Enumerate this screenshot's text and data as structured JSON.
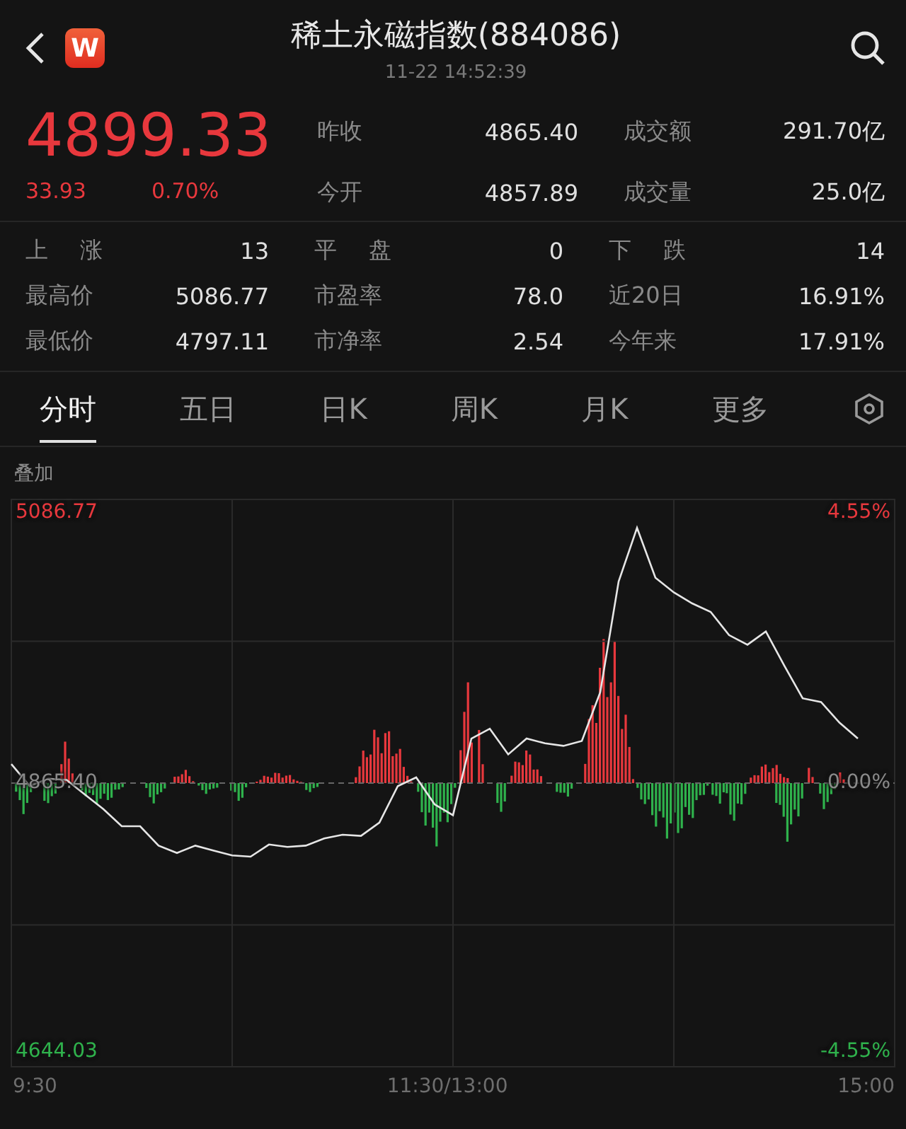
{
  "header": {
    "logo": "W",
    "title": "稀土永磁指数(884086)",
    "timestamp": "11-22 14:52:39"
  },
  "quote": {
    "price": "4899.33",
    "change": "33.93",
    "change_pct": "0.70%"
  },
  "summary": [
    {
      "label": "昨收",
      "value": "4865.40"
    },
    {
      "label": "成交额",
      "value": "291.70亿"
    },
    {
      "label": "今开",
      "value": "4857.89"
    },
    {
      "label": "成交量",
      "value": "25.0亿"
    }
  ],
  "stats": [
    {
      "label": "上 涨",
      "value": "13"
    },
    {
      "label": "平 盘",
      "value": "0"
    },
    {
      "label": "下 跌",
      "value": "14"
    },
    {
      "label": "最高价",
      "value": "5086.77"
    },
    {
      "label": "市盈率",
      "value": "78.0"
    },
    {
      "label": "近20日",
      "value": "16.91%"
    },
    {
      "label": "最低价",
      "value": "4797.11"
    },
    {
      "label": "市净率",
      "value": "2.54"
    },
    {
      "label": "今年来",
      "value": "17.91%"
    }
  ],
  "tabs": [
    {
      "label": "分时",
      "selected": true
    },
    {
      "label": "五日",
      "selected": false
    },
    {
      "label": "日K",
      "selected": false
    },
    {
      "label": "周K",
      "selected": false
    },
    {
      "label": "月K",
      "selected": false
    },
    {
      "label": "更多",
      "selected": false
    }
  ],
  "overlay_label": "叠加",
  "chart": {
    "percent_labels": [
      "4.55%",
      "0.00%",
      "-4.55%"
    ],
    "time_labels": [
      "9:30",
      "11:30/13:00",
      "15:00"
    ],
    "chart_data": {
      "type": "line",
      "categories": [
        null,
        null,
        null,
        null,
        null,
        null,
        null,
        null,
        null,
        null,
        null,
        null,
        null,
        null,
        null,
        null,
        null,
        null,
        null,
        null,
        null,
        null,
        null,
        null,
        null,
        null,
        null,
        null,
        null,
        null,
        null,
        null,
        null,
        null,
        null,
        null,
        null,
        null,
        null,
        null,
        null,
        null,
        null,
        null,
        null,
        null,
        null,
        null,
        null
      ],
      "series": [
        {
          "color": "#e6e6e6",
          "values": [
            4881,
            4863,
            4869,
            4868,
            4856,
            4844,
            4830,
            4830,
            4814,
            4808,
            4814,
            4810,
            4806,
            4805,
            4815,
            4813,
            4814,
            4820,
            4823,
            4822,
            4833,
            4863,
            4870,
            4848,
            4839,
            4902,
            4910,
            4889,
            4902,
            4898,
            4896,
            4900,
            4940,
            5031,
            5075,
            5034,
            5022,
            5013,
            5006,
            4987,
            4979,
            4990,
            4962,
            4935,
            4932,
            4915,
            4902,
            null,
            null
          ]
        }
      ],
      "ylim": [
        4632.41,
        5098.39
      ],
      "grid": true,
      "ref_lines": [
        {
          "axis": "y",
          "value": 4865.4
        }
      ],
      "yticks": [
        {
          "value": 5086.77,
          "label": "5086.77"
        },
        {
          "value": 4865.4,
          "label": "4865.40"
        },
        {
          "value": 4644.03,
          "label": "4644.03"
        }
      ]
    }
  }
}
